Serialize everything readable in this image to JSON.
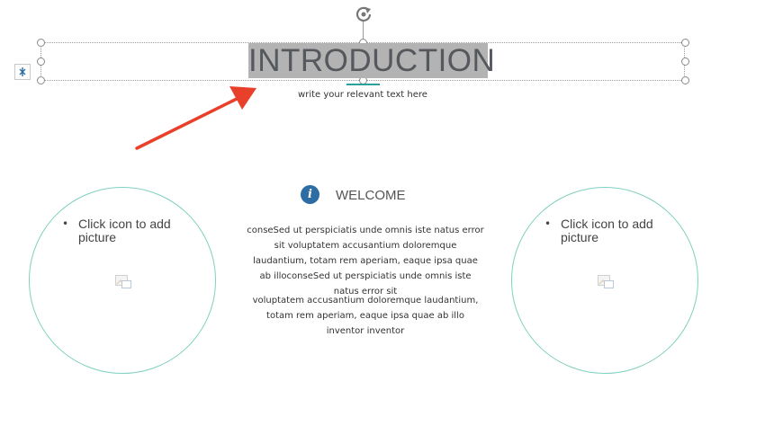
{
  "slide": {
    "title": "INTRODUCTION",
    "subtitle": "write your relevant text here",
    "welcome_heading": "WELCOME",
    "paragraph_1": "conseSed ut perspiciatis unde omnis iste natus error sit voluptatem accusantium doloremque laudantium, totam rem aperiam, eaque ipsa quae ab illoconseSed ut perspiciatis unde omnis iste natus error sit",
    "paragraph_2": "voluptatem accusantium doloremque laudantium, totam rem aperiam, eaque ipsa quae ab illo inventor inventor"
  },
  "placeholders": {
    "left": {
      "label": "Click icon to add picture",
      "bullet": "•",
      "icon": "picture-icon"
    },
    "right": {
      "label": "Click icon to add picture",
      "bullet": "•",
      "icon": "picture-icon"
    }
  },
  "icons": {
    "info": "i",
    "rotate": "rotate-icon",
    "layout_options": "layout-options-icon"
  },
  "colors": {
    "selection_highlight": "#b3b3b3",
    "circle_outline": "#7fd0bf",
    "arrow": "#e8402a",
    "info_badge": "#2e6da4",
    "caret_underline": "#2aa19b"
  }
}
